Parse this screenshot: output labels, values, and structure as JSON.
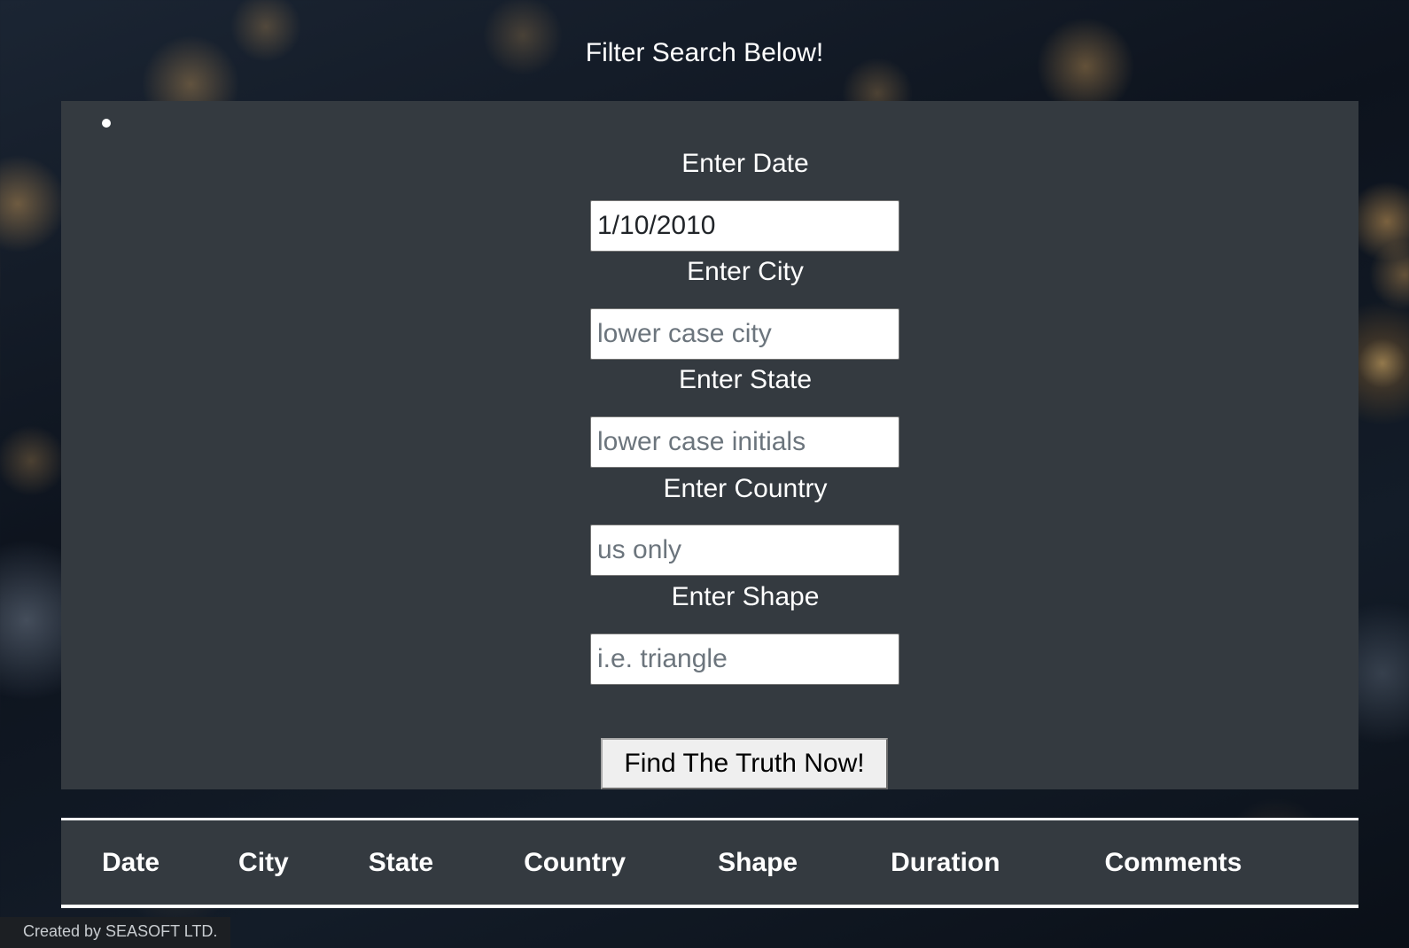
{
  "page": {
    "title": "Filter Search Below!"
  },
  "filters": [
    {
      "label": "Enter Date",
      "value": "1/10/2010",
      "placeholder": ""
    },
    {
      "label": "Enter City",
      "value": "",
      "placeholder": "lower case city"
    },
    {
      "label": "Enter State",
      "value": "",
      "placeholder": "lower case initials"
    },
    {
      "label": "Enter Country",
      "value": "",
      "placeholder": "us only"
    },
    {
      "label": "Enter Shape",
      "value": "",
      "placeholder": "i.e. triangle"
    }
  ],
  "search_button": {
    "label": "Find The Truth Now!"
  },
  "table": {
    "headers": [
      "Date",
      "City",
      "State",
      "Country",
      "Shape",
      "Duration",
      "Comments"
    ]
  },
  "footer": {
    "credit": "Created by SEASOFT LTD."
  },
  "colors": {
    "panel": "#343a40",
    "text": "#ffffff",
    "input_background": "#ffffff",
    "button_background": "#efefef"
  }
}
